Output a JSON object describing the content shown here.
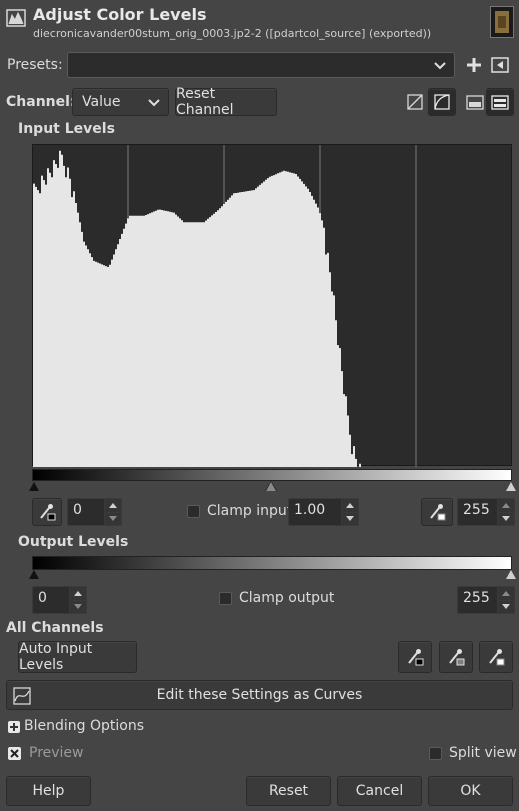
{
  "header": {
    "title": "Adjust Color Levels",
    "subtitle": "diecronicavander00stum_orig_0003.jp2-2 ([pdartcol_source] (exported))"
  },
  "presets": {
    "label": "Presets:",
    "value": ""
  },
  "channel": {
    "label": "Channel:",
    "value": "Value",
    "reset_label": "Reset Channel"
  },
  "input_levels": {
    "heading": "Input Levels",
    "low": "0",
    "gamma": "1.00",
    "high": "255",
    "clamp_label": "Clamp input"
  },
  "output_levels": {
    "heading": "Output Levels",
    "low": "0",
    "high": "255",
    "clamp_label": "Clamp output"
  },
  "all_channels": {
    "heading": "All Channels",
    "auto_label": "Auto Input Levels"
  },
  "curves_label": "Edit these Settings as Curves",
  "blending_label": "Blending Options",
  "preview_label": "Preview",
  "split_view_label": "Split view",
  "buttons": {
    "help": "Help",
    "reset": "Reset",
    "cancel": "Cancel",
    "ok": "OK"
  },
  "colors": {
    "background": "#454545",
    "histogram_bg": "#2b2b2b",
    "histogram_fill": "#e6e6e6"
  },
  "icons": [
    "levels-icon",
    "plus-icon",
    "save-to-preset-icon",
    "linear-histogram-icon",
    "log-histogram-icon",
    "histogram-view-icon",
    "histogram-view-alt-icon",
    "black-picker-icon",
    "gray-picker-icon",
    "white-picker-icon",
    "curves-icon",
    "expand-icon",
    "preview-check-icon"
  ]
}
